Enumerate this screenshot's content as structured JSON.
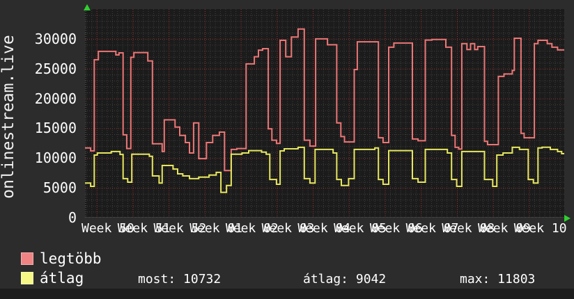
{
  "site_label": "onlinestream.live",
  "colors": {
    "background": "#2c2c2c",
    "plot_background": "#1b1b1b",
    "minor_grid": "#3f3f3f",
    "major_grid": "#943737",
    "axis_arrow": "#2fd02f",
    "series_max": "#ee7676",
    "series_avg": "#e7e75f",
    "text": "#ffffff"
  },
  "legend": {
    "items": [
      {
        "label": "legtöbb",
        "color": "#f08484"
      },
      {
        "label": "átlag",
        "color": "#f7f786"
      }
    ]
  },
  "stats": [
    {
      "name": "most",
      "text": "most: 10732"
    },
    {
      "name": "atlag",
      "text": "átlag: 9042"
    },
    {
      "name": "max",
      "text": "max: 11803"
    }
  ],
  "chart_data": {
    "type": "line",
    "subtype": "step",
    "title": "onlinestream.live",
    "xlabel": "",
    "ylabel": "onlinestream.live",
    "ylim": [
      0,
      35000
    ],
    "y_ticks": [
      0,
      5000,
      10000,
      15000,
      20000,
      25000,
      30000
    ],
    "x_tick_labels": [
      "Week 50",
      "Week 51",
      "Week 52",
      "Week 01",
      "Week 02",
      "Week 03",
      "Week 04",
      "Week 05",
      "Week 06",
      "Week 07",
      "Week 08",
      "Week 09",
      "Week 10"
    ],
    "x_unit": "days",
    "x_total_days": 93.1,
    "first_week_tick_day": 2.26,
    "days_per_week": 7,
    "grid": true,
    "legend_position": "bottom-left",
    "summary": {
      "most": 10732,
      "atlag": 9042,
      "max": 11803
    },
    "series": [
      {
        "name": "legtöbb",
        "color": "#ee7676",
        "points": [
          [
            0,
            11700
          ],
          [
            1.1,
            11200
          ],
          [
            1.8,
            26500
          ],
          [
            2.6,
            27900
          ],
          [
            6.0,
            27300
          ],
          [
            6.6,
            27650
          ],
          [
            7.4,
            13900
          ],
          [
            8.1,
            11600
          ],
          [
            8.9,
            26900
          ],
          [
            9.5,
            27700
          ],
          [
            12.2,
            26300
          ],
          [
            13.1,
            12400
          ],
          [
            15.0,
            11100
          ],
          [
            15.4,
            16400
          ],
          [
            17.5,
            15200
          ],
          [
            18.4,
            13800
          ],
          [
            19.5,
            12600
          ],
          [
            20.3,
            10850
          ],
          [
            21.1,
            15900
          ],
          [
            22.1,
            9900
          ],
          [
            23.6,
            12600
          ],
          [
            24.8,
            13800
          ],
          [
            26.1,
            14350
          ],
          [
            27.1,
            7900
          ],
          [
            28.4,
            11450
          ],
          [
            29.5,
            11600
          ],
          [
            31.3,
            25800
          ],
          [
            32.9,
            27000
          ],
          [
            33.7,
            28100
          ],
          [
            34.5,
            28350
          ],
          [
            35.6,
            14900
          ],
          [
            36.3,
            13000
          ],
          [
            37.2,
            12450
          ],
          [
            37.9,
            29750
          ],
          [
            39.0,
            27000
          ],
          [
            40.1,
            30300
          ],
          [
            41.4,
            31650
          ],
          [
            42.6,
            13000
          ],
          [
            43.7,
            12000
          ],
          [
            44.8,
            30000
          ],
          [
            47.1,
            29000
          ],
          [
            48.9,
            15900
          ],
          [
            49.7,
            13600
          ],
          [
            50.4,
            12700
          ],
          [
            52.3,
            24850
          ],
          [
            52.9,
            29500
          ],
          [
            57.0,
            13400
          ],
          [
            57.9,
            12600
          ],
          [
            59.0,
            28600
          ],
          [
            60.0,
            29300
          ],
          [
            63.6,
            13200
          ],
          [
            64.7,
            12900
          ],
          [
            66.1,
            29800
          ],
          [
            67.4,
            29900
          ],
          [
            70.1,
            28600
          ],
          [
            71.2,
            13800
          ],
          [
            71.9,
            11800
          ],
          [
            72.6,
            11500
          ],
          [
            73.2,
            29200
          ],
          [
            74.2,
            28200
          ],
          [
            74.9,
            29200
          ],
          [
            75.7,
            28200
          ],
          [
            76.3,
            28700
          ],
          [
            77.6,
            12800
          ],
          [
            78.2,
            12250
          ],
          [
            80.3,
            23700
          ],
          [
            81.4,
            24100
          ],
          [
            83.0,
            24700
          ],
          [
            83.4,
            30100
          ],
          [
            84.7,
            14150
          ],
          [
            85.3,
            13400
          ],
          [
            87.3,
            29200
          ],
          [
            88.0,
            29750
          ],
          [
            89.8,
            29200
          ],
          [
            90.7,
            28600
          ],
          [
            91.8,
            28150
          ]
        ]
      },
      {
        "name": "átlag",
        "color": "#e7e75f",
        "points": [
          [
            0,
            5800
          ],
          [
            1.1,
            5250
          ],
          [
            1.8,
            10500
          ],
          [
            2.4,
            10850
          ],
          [
            5.1,
            11100
          ],
          [
            6.8,
            10600
          ],
          [
            7.4,
            6550
          ],
          [
            8.3,
            5950
          ],
          [
            9.1,
            10650
          ],
          [
            12.5,
            10300
          ],
          [
            13.1,
            7000
          ],
          [
            14.4,
            5800
          ],
          [
            15.0,
            8750
          ],
          [
            17.1,
            8150
          ],
          [
            18.0,
            7350
          ],
          [
            19.0,
            7000
          ],
          [
            20.3,
            6550
          ],
          [
            22.1,
            6800
          ],
          [
            24.1,
            7150
          ],
          [
            25.5,
            7600
          ],
          [
            26.4,
            4250
          ],
          [
            27.5,
            5400
          ],
          [
            28.4,
            10650
          ],
          [
            30.5,
            10850
          ],
          [
            31.8,
            11250
          ],
          [
            34.3,
            11000
          ],
          [
            35.2,
            10650
          ],
          [
            35.9,
            6400
          ],
          [
            37.2,
            5600
          ],
          [
            37.9,
            11200
          ],
          [
            38.7,
            11550
          ],
          [
            41.4,
            11800
          ],
          [
            42.6,
            6550
          ],
          [
            43.7,
            5800
          ],
          [
            44.7,
            11450
          ],
          [
            48.2,
            10850
          ],
          [
            48.9,
            6400
          ],
          [
            49.8,
            5400
          ],
          [
            51.2,
            6550
          ],
          [
            52.3,
            11450
          ],
          [
            56.3,
            11700
          ],
          [
            57.0,
            6400
          ],
          [
            57.9,
            5600
          ],
          [
            59.0,
            11250
          ],
          [
            63.6,
            6550
          ],
          [
            64.7,
            5950
          ],
          [
            66.1,
            11450
          ],
          [
            70.4,
            10850
          ],
          [
            71.2,
            6400
          ],
          [
            72.2,
            5250
          ],
          [
            73.2,
            11100
          ],
          [
            77.6,
            6400
          ],
          [
            79.2,
            5250
          ],
          [
            80.0,
            10500
          ],
          [
            81.2,
            10850
          ],
          [
            83.0,
            11800
          ],
          [
            84.4,
            11450
          ],
          [
            86.1,
            6400
          ],
          [
            87.1,
            5800
          ],
          [
            88.0,
            11700
          ],
          [
            88.8,
            11803
          ],
          [
            90.4,
            11450
          ],
          [
            91.8,
            11100
          ],
          [
            92.6,
            10732
          ]
        ]
      }
    ]
  }
}
